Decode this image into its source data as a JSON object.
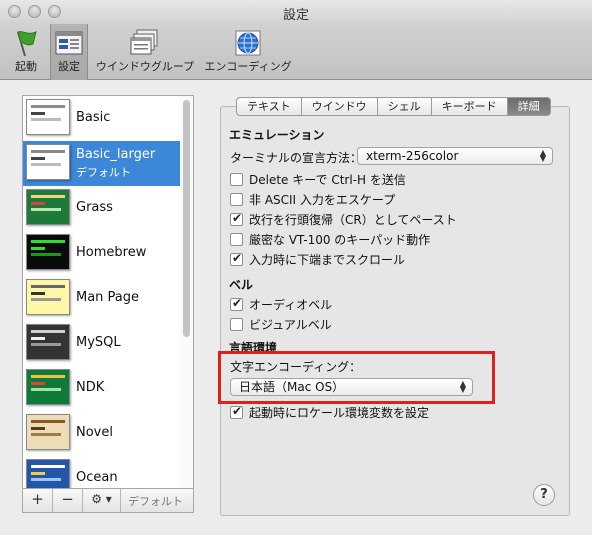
{
  "window": {
    "title": "設定"
  },
  "toolbar": {
    "items": [
      {
        "label": "起動",
        "icon": "startup-flag-icon"
      },
      {
        "label": "設定",
        "icon": "settings-window-icon"
      },
      {
        "label": "ウインドウグループ",
        "icon": "window-groups-icon"
      },
      {
        "label": "エンコーディング",
        "icon": "encoding-globe-icon"
      }
    ]
  },
  "profiles": [
    {
      "name": "Basic",
      "sub": ""
    },
    {
      "name": "Basic_larger",
      "sub": "デフォルト"
    },
    {
      "name": "Grass",
      "sub": ""
    },
    {
      "name": "Homebrew",
      "sub": ""
    },
    {
      "name": "Man Page",
      "sub": ""
    },
    {
      "name": "MySQL",
      "sub": ""
    },
    {
      "name": "NDK",
      "sub": ""
    },
    {
      "name": "Novel",
      "sub": ""
    },
    {
      "name": "Ocean",
      "sub": ""
    }
  ],
  "list_controls": {
    "add": "+",
    "remove": "−",
    "gear": "⚙ ▾",
    "default_label": "デフォルト"
  },
  "tabs": [
    "テキスト",
    "ウインドウ",
    "シェル",
    "キーボード",
    "詳細"
  ],
  "emulation": {
    "title": "エミュレーション",
    "terminal_type_label": "ターミナルの宣言方法：",
    "terminal_type_value": "xterm-256color",
    "options": [
      {
        "label": "Delete キーで Ctrl-H を送信",
        "checked": false
      },
      {
        "label": "非 ASCII 入力をエスケープ",
        "checked": false
      },
      {
        "label": "改行を行頭復帰（CR）としてペースト",
        "checked": true
      },
      {
        "label": "厳密な VT-100 のキーパッド動作",
        "checked": false
      },
      {
        "label": "入力時に下端までスクロール",
        "checked": true
      }
    ]
  },
  "bell": {
    "title": "ベル",
    "options": [
      {
        "label": "オーディオベル",
        "checked": true
      },
      {
        "label": "ビジュアルベル",
        "checked": false
      }
    ]
  },
  "language": {
    "title": "言語環境",
    "encoding_label": "文字エンコーディング：",
    "encoding_value": "日本語（Mac OS）",
    "locale_option": {
      "label": "起動時にロケール環境変数を設定",
      "checked": true
    }
  },
  "help_label": "?",
  "colors": {
    "selection": "#3d87d8",
    "highlight_box": "#e0201b"
  }
}
